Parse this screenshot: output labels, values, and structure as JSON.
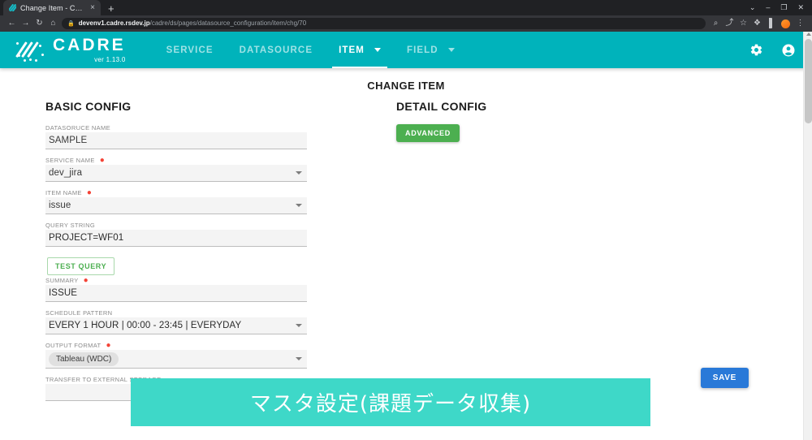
{
  "browser": {
    "tab": {
      "title": "Change Item - Cadre",
      "favicon": "cadre-favicon",
      "close": "×"
    },
    "new_tab": "+",
    "window_controls": {
      "minimize_chevron": "⌄",
      "minimize": "–",
      "maximize": "❐",
      "close": "✕"
    },
    "nav": {
      "back": "←",
      "forward": "→",
      "reload": "↻",
      "home": "⌂"
    },
    "omnibox": {
      "lock": "🔒",
      "url_domain": "devenv1.cadre.rsdev.jp",
      "url_path": "/cadre/ds/pages/datasource_configuration/item/chg/70"
    },
    "toolbar_right": {
      "zoom": "⌕",
      "share": "⤴",
      "bookmark": "☆",
      "extensions": "✦",
      "sidepanel": "panel",
      "profile": "avatar",
      "menu": "⋮"
    }
  },
  "appbar": {
    "brand": "CADRE",
    "version": "ver 1.13.0",
    "nav_items": [
      {
        "label": "SERVICE",
        "active": false,
        "has_caret": false
      },
      {
        "label": "DATASOURCE",
        "active": false,
        "has_caret": false
      },
      {
        "label": "ITEM",
        "active": true,
        "has_caret": true
      },
      {
        "label": "FIELD",
        "active": false,
        "has_caret": true
      }
    ],
    "settings_icon": "gear-icon",
    "account_icon": "account-icon",
    "background_color": "#00b3bb"
  },
  "page": {
    "title": "CHANGE ITEM",
    "basic_config": {
      "heading": "BASIC CONFIG",
      "fields": [
        {
          "label": "DATASORUCE NAME",
          "value": "SAMPLE",
          "required": false,
          "type": "text"
        },
        {
          "label": "SERVICE NAME",
          "value": "dev_jira",
          "required": true,
          "type": "select"
        },
        {
          "label": "ITEM NAME",
          "value": "issue",
          "required": true,
          "type": "select"
        },
        {
          "label": "QUERY STRING",
          "value": "PROJECT=WF01",
          "required": false,
          "type": "text"
        },
        {
          "label": "SUMMARY",
          "value": "ISSUE",
          "required": true,
          "type": "text"
        },
        {
          "label": "SCHEDULE PATTERN",
          "value": "EVERY 1 HOUR | 00:00 - 23:45 | EVERYDAY",
          "required": false,
          "type": "select"
        },
        {
          "label": "OUTPUT FORMAT",
          "value": "Tableau (WDC)",
          "required": true,
          "type": "chip-select"
        },
        {
          "label": "TRANSFER TO EXTERNAL STORAGE",
          "value": "",
          "required": false,
          "type": "select"
        }
      ],
      "test_query_button": "TEST QUERY"
    },
    "detail_config": {
      "heading": "DETAIL CONFIG",
      "advanced_button": "ADVANCED"
    },
    "save_button": "SAVE",
    "banner": {
      "text": "マスタ設定(課題データ収集)",
      "background_color": "#3ed8c8"
    }
  }
}
